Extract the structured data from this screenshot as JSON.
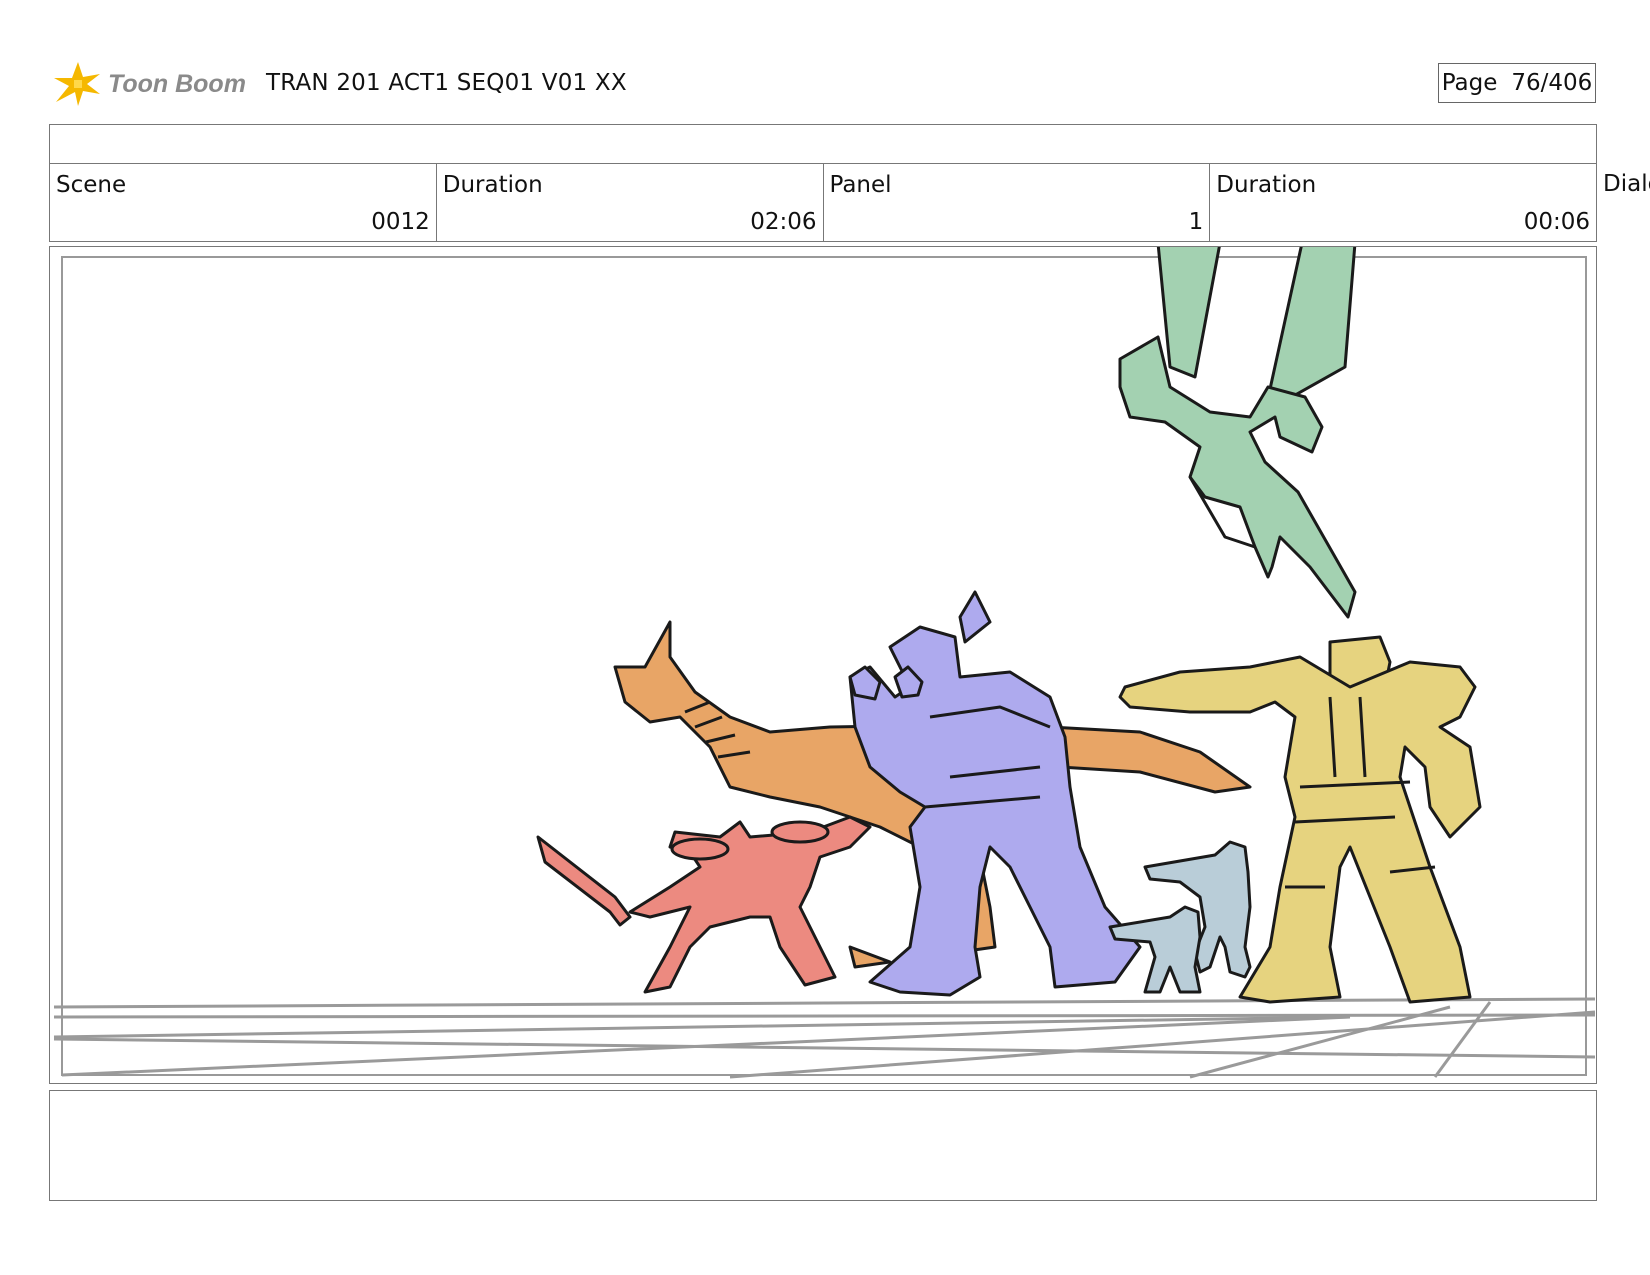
{
  "header": {
    "logo_text": "Toon Boom",
    "doc_title": "TRAN 201 ACT1 SEQ01 V01 XX",
    "page_label": "Page",
    "page_value": "76/406"
  },
  "info": {
    "scene_label": "Scene",
    "scene_value": "0012",
    "scene_duration_label": "Duration",
    "scene_duration_value": "02:06",
    "panel_label": "Panel",
    "panel_value": "1",
    "panel_duration_label": "Duration",
    "panel_duration_value": "00:06",
    "dialog_label": "Dialog"
  },
  "colors": {
    "green_robot": "#a3d1b1",
    "orange_dino": "#e8a566",
    "purple_robot": "#aeaaee",
    "red_robot": "#ec8a80",
    "gray_figures": "#b9cdd8",
    "yellow_robot": "#e6d37f",
    "logo_star": "#f5b800",
    "frame_line": "#777777"
  },
  "icons": {
    "logo": "toon-boom-star-icon"
  }
}
